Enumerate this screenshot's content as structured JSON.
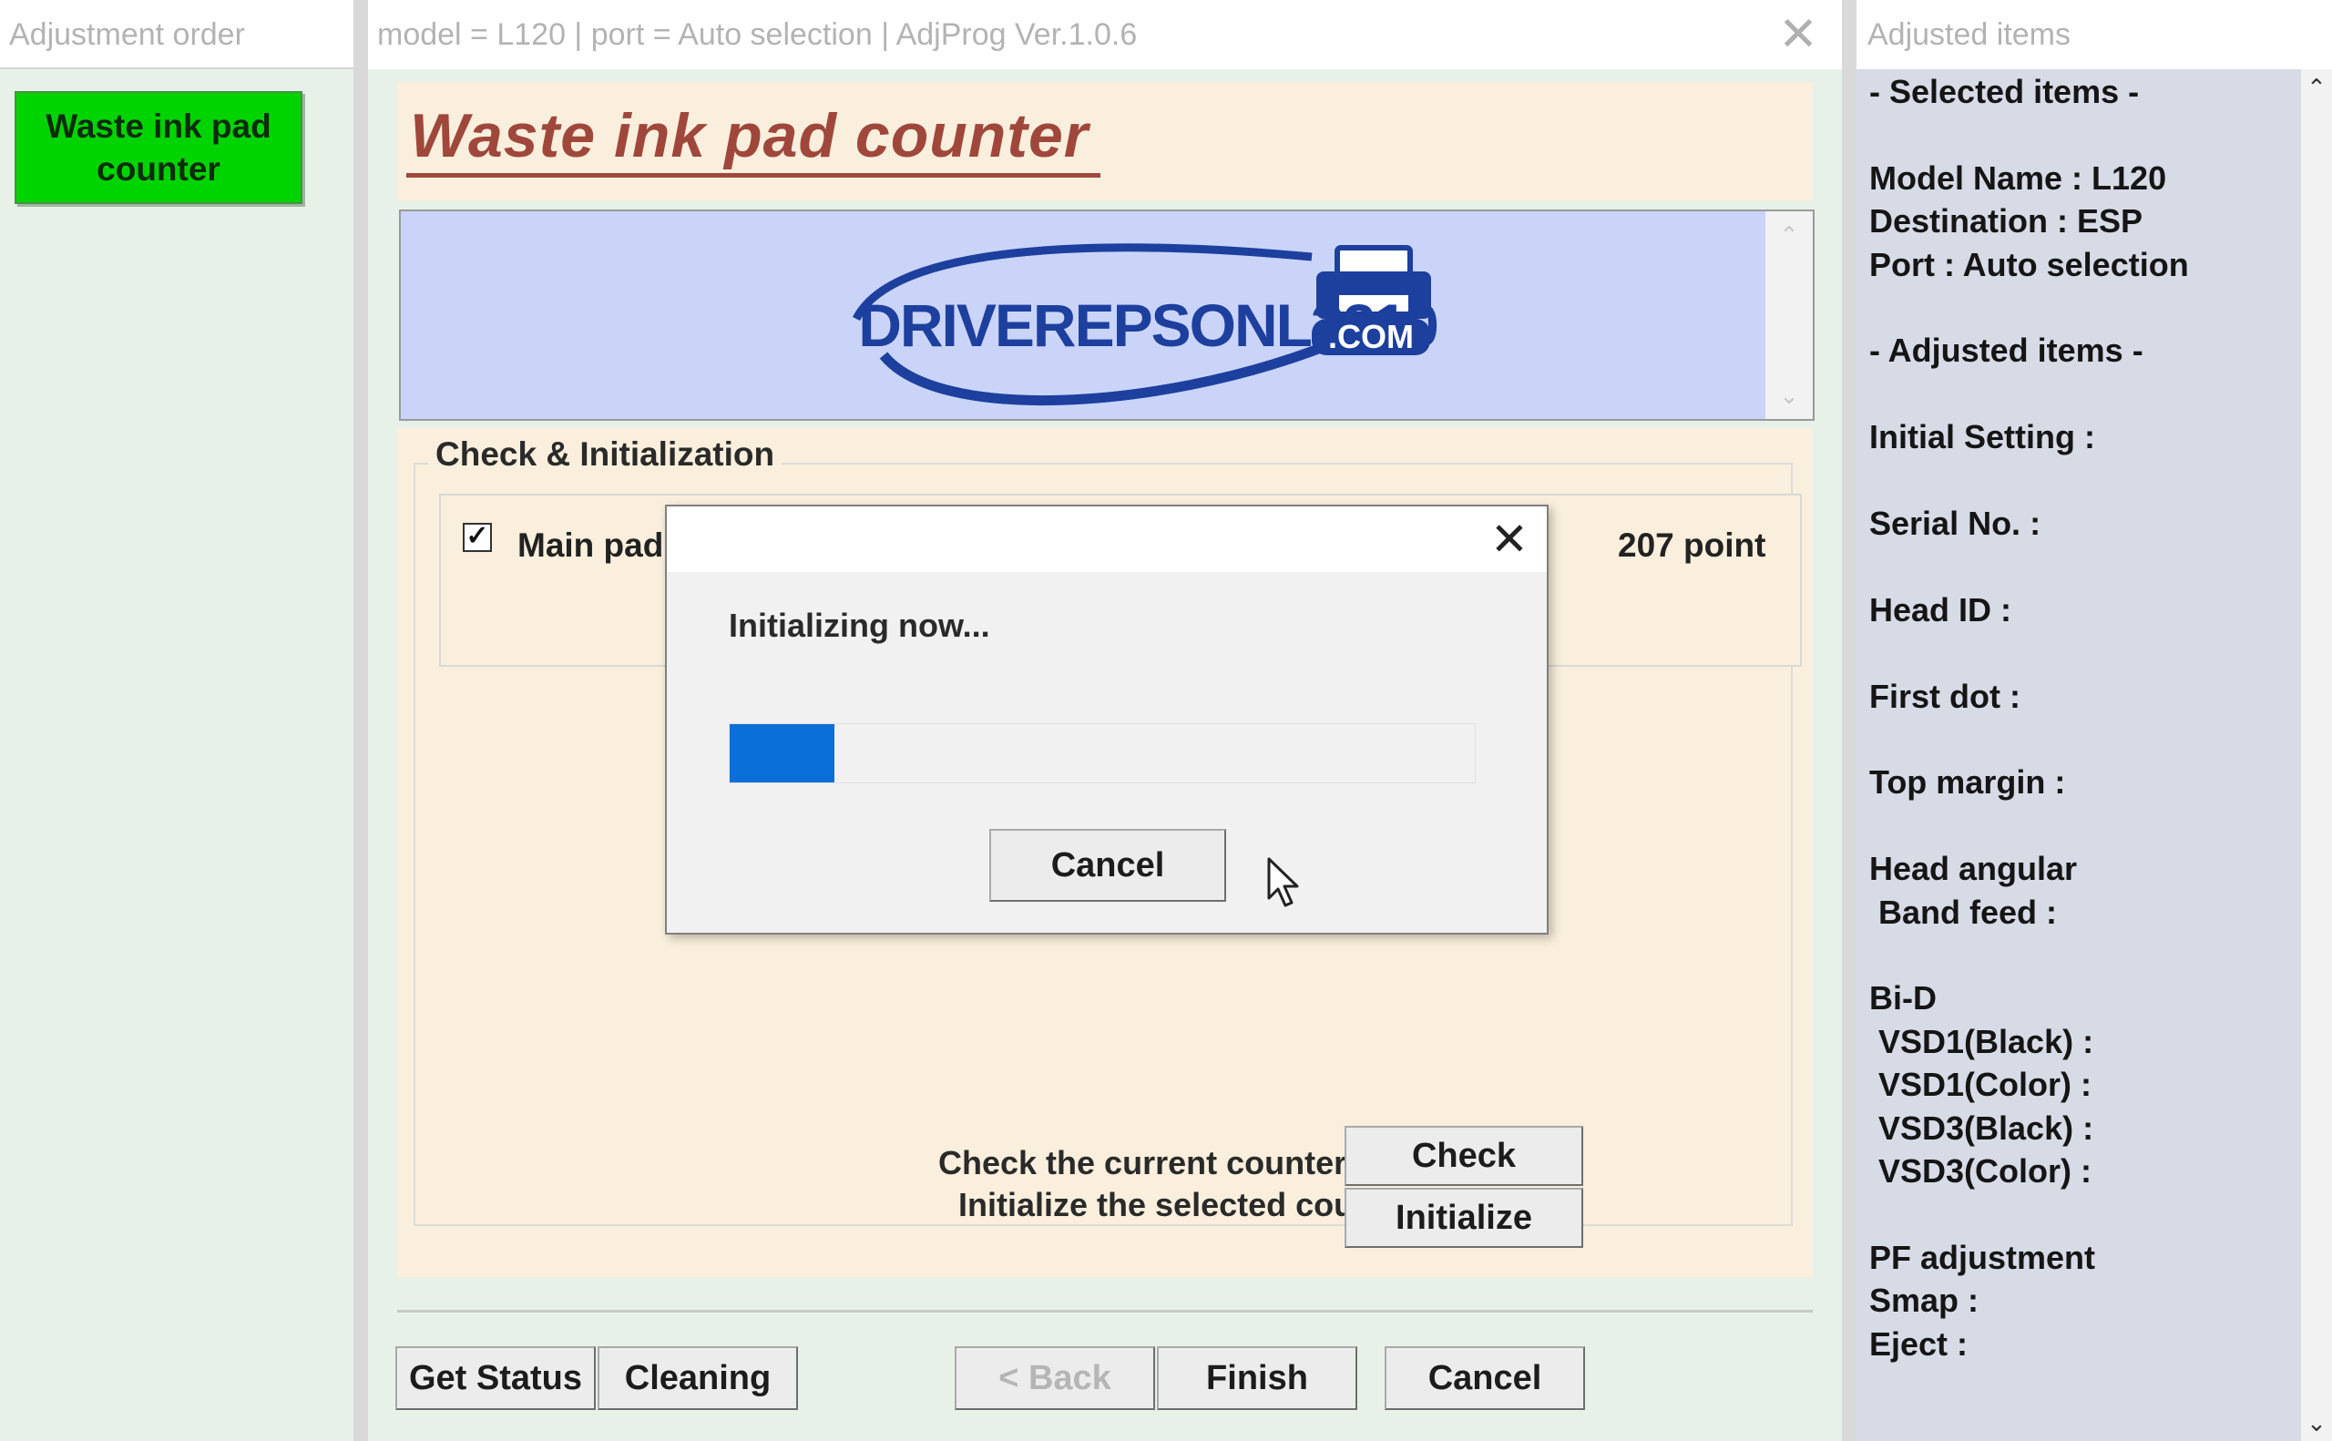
{
  "left_panel": {
    "title": "Adjustment order",
    "active_item": "Waste ink pad counter"
  },
  "main_window": {
    "title": "model = L120 | port = Auto selection | AdjProg Ver.1.0.6",
    "page_title": "Waste ink pad counter",
    "banner": {
      "brand": "DRIVEREPSONL3210",
      "suffix": ".COM"
    },
    "group_label": "Check & Initialization",
    "counter_row": {
      "label": "Main pad",
      "checked": true,
      "value_text": "207 point"
    },
    "check_prompt": "Check the current counter value. -->",
    "check_button": "Check",
    "init_prompt": "Initialize the selected counters. -->",
    "init_button": "Initialize",
    "footer": {
      "get_status": "Get Status",
      "cleaning": "Cleaning",
      "back": "< Back",
      "finish": "Finish",
      "cancel": "Cancel"
    }
  },
  "dialog": {
    "message": "Initializing now...",
    "progress": 0.14,
    "cancel_button": "Cancel"
  },
  "right_panel": {
    "title": "Adjusted items",
    "lines": [
      "- Selected items -",
      "",
      "Model Name : L120",
      "Destination : ESP",
      "Port : Auto selection",
      "",
      "- Adjusted items -",
      "",
      "Initial Setting :",
      "",
      "Serial No. :",
      "",
      "Head ID :",
      "",
      "First dot :",
      "",
      "Top margin :",
      "",
      "Head angular",
      " Band feed :",
      "",
      "Bi-D",
      " VSD1(Black) :",
      " VSD1(Color) :",
      " VSD3(Black) :",
      " VSD3(Color) :",
      "",
      "PF adjustment",
      "Smap :",
      "Eject :"
    ]
  },
  "colors": {
    "accent_green": "#00d400",
    "title_red": "#a0473c",
    "progress_blue": "#0a6fd8",
    "banner_bg": "#c9d4f8",
    "panel_bg": "#f9efdc"
  }
}
